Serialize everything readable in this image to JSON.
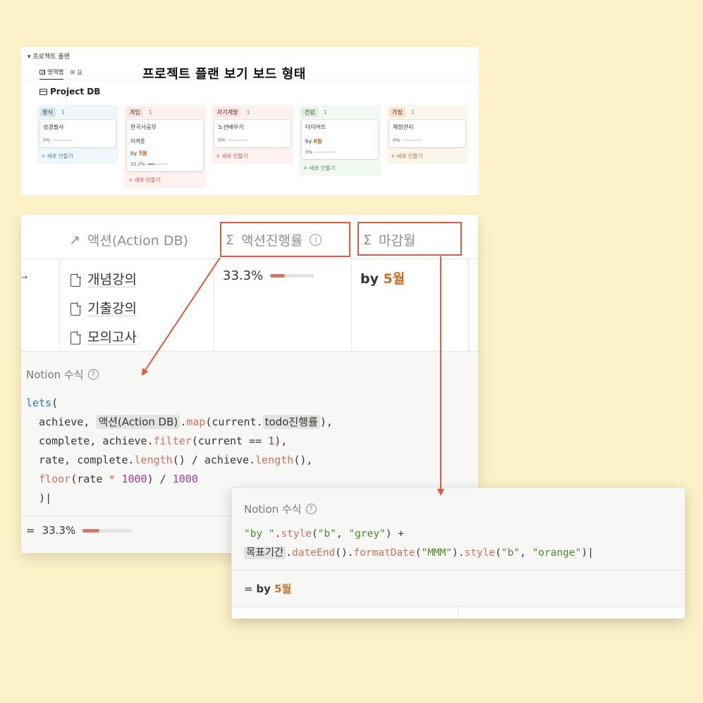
{
  "board": {
    "toggle_label": "▾ 프로젝트 플랜",
    "views": [
      {
        "label": "영역별",
        "active": true
      },
      {
        "label": "표",
        "active": false
      }
    ],
    "headline": "프로젝트 플랜 보기 보드 형태",
    "db_title": "Project DB",
    "columns": [
      {
        "tag": "형식",
        "count": "1",
        "tag_bg": "#d3e5ef",
        "col_bg": "#f0f7fb",
        "add_color": "#3f7fa6",
        "card": {
          "title": "성경필사",
          "lines": [],
          "pct": "0%",
          "fill": 0
        }
      },
      {
        "tag": "게임",
        "count": "1",
        "tag_bg": "#ffe2dd",
        "col_bg": "#fdf2f0",
        "add_color": "#c4554d",
        "card": {
          "title": "한국사공부",
          "lines": [
            "자격증"
          ],
          "by_prefix": "by ",
          "by_month": "5월",
          "pct": "33.3%",
          "fill": 0.333
        }
      },
      {
        "tag": "자기계발",
        "count": "1",
        "tag_bg": "#ffe2dd",
        "col_bg": "#fdf2f0",
        "add_color": "#c4554d",
        "card": {
          "title": "노션배우기",
          "lines": [],
          "pct": "0%",
          "fill": 0
        }
      },
      {
        "tag": "건강",
        "count": "1",
        "tag_bg": "#dbeddb",
        "col_bg": "#f2f8f2",
        "add_color": "#448361",
        "card": {
          "title": "다이어트",
          "lines": [],
          "by_prefix": "by ",
          "by_month": "6월",
          "pct": "0%",
          "fill": 0
        }
      },
      {
        "tag": "가정",
        "count": "1",
        "tag_bg": "#fadec9",
        "col_bg": "#fbf6ec",
        "add_color": "#b06e2a",
        "card": {
          "title": "재정관리",
          "lines": [],
          "pct": "0%",
          "fill": 0
        }
      }
    ],
    "add_new_label": "+ 새로 만들기"
  },
  "table": {
    "col_action": "액션(Action DB)",
    "col_progress": "액션진행률",
    "col_deadline": "마감월",
    "pages": [
      "개념강의",
      "기출강의",
      "모의고사"
    ],
    "progress_value": "33.3%",
    "progress_fill": 0.333,
    "by_prefix": "by ",
    "by_month": "5월"
  },
  "formula1": {
    "title": "Notion 수식",
    "code": [
      [
        {
          "t": "lets",
          "c": "kw"
        },
        {
          "t": "("
        }
      ],
      [
        {
          "t": "  achieve, "
        },
        {
          "t": "액션(Action DB)",
          "c": "tok"
        },
        {
          "t": "."
        },
        {
          "t": "map",
          "c": "fn"
        },
        {
          "t": "(current."
        },
        {
          "t": "todo진행률",
          "c": "tok"
        },
        {
          "t": "),"
        }
      ],
      [
        {
          "t": "  complete, achieve."
        },
        {
          "t": "filter",
          "c": "fn"
        },
        {
          "t": "(current == "
        },
        {
          "t": "1",
          "c": "num"
        },
        {
          "t": "),"
        }
      ],
      [
        {
          "t": "  rate, complete."
        },
        {
          "t": "length",
          "c": "fn"
        },
        {
          "t": "() / achieve."
        },
        {
          "t": "length",
          "c": "fn"
        },
        {
          "t": "(),"
        }
      ],
      [
        {
          "t": "  "
        },
        {
          "t": "floor",
          "c": "fn"
        },
        {
          "t": "(rate "
        },
        {
          "t": "*",
          "c": "fn"
        },
        {
          "t": " "
        },
        {
          "t": "1000",
          "c": "num"
        },
        {
          "t": ") / "
        },
        {
          "t": "1000",
          "c": "num"
        }
      ],
      [
        {
          "t": "  )|"
        }
      ]
    ],
    "result_prefix": "=",
    "result_value": "33.3%",
    "result_fill": 0.333
  },
  "formula2": {
    "title": "Notion 수식",
    "code": [
      [
        {
          "t": "\"by \"",
          "c": "str"
        },
        {
          "t": "."
        },
        {
          "t": "style",
          "c": "fn"
        },
        {
          "t": "("
        },
        {
          "t": "\"b\"",
          "c": "str"
        },
        {
          "t": ", "
        },
        {
          "t": "\"grey\"",
          "c": "str"
        },
        {
          "t": ") +"
        }
      ],
      [
        {
          "t": "목표기간",
          "c": "tok"
        },
        {
          "t": "."
        },
        {
          "t": "dateEnd",
          "c": "fn"
        },
        {
          "t": "()."
        },
        {
          "t": "formatDate",
          "c": "fn"
        },
        {
          "t": "("
        },
        {
          "t": "\"MMM\"",
          "c": "str"
        },
        {
          "t": ")."
        },
        {
          "t": "style",
          "c": "fn"
        },
        {
          "t": "("
        },
        {
          "t": "\"b\"",
          "c": "str"
        },
        {
          "t": ", "
        },
        {
          "t": "\"orange\"",
          "c": "str"
        },
        {
          "t": ")|"
        }
      ]
    ],
    "result_prefix": "= ",
    "result_by": "by ",
    "result_month": "5월"
  },
  "colors": {
    "background": "#fdf1c7",
    "highlight_box": "#e8573a",
    "progress_fill": "#d1786b",
    "month_orange": "#c7702a"
  }
}
